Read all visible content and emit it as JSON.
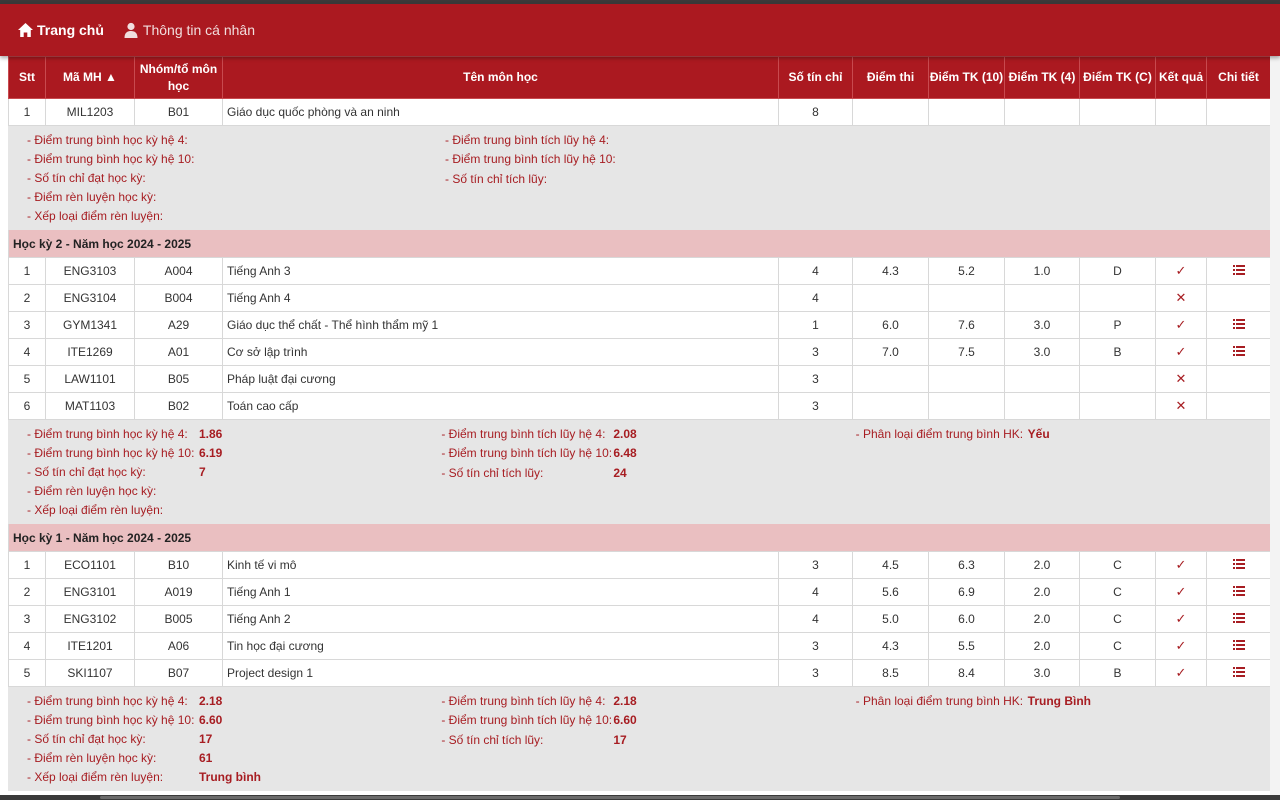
{
  "nav": {
    "home": "Trang chủ",
    "profile": "Thông tin cá nhân"
  },
  "columns": [
    "Stt",
    "Mã MH ▲",
    "Nhóm/tổ môn học",
    "Tên môn học",
    "Số tín chỉ",
    "Điểm thi",
    "Điểm TK (10)",
    "Điểm TK (4)",
    "Điểm TK (C)",
    "Kết quả",
    "Chi tiết"
  ],
  "labels": {
    "gpa4": "- Điểm trung bình học kỳ hệ 4:",
    "gpa10": "- Điểm trung bình học kỳ hệ 10:",
    "credits_sem": "- Số tín chỉ đạt học kỳ:",
    "conduct": "- Điểm rèn luyện học kỳ:",
    "conduct_rank": "- Xếp loại điểm rèn luyện:",
    "cum4": "- Điểm trung bình tích lũy hệ 4:",
    "cum10": "- Điểm trung bình tích lũy hệ 10:",
    "cum_credits": "- Số tín chỉ tích lũy:",
    "classify": "- Phân loại điểm trung bình HK:"
  },
  "first_block": {
    "row": {
      "stt": "1",
      "code": "MIL1203",
      "group": "B01",
      "name": "Giáo dục quốc phòng và an ninh",
      "credits": "8",
      "exam": "",
      "tk10": "",
      "tk4": "",
      "tkc": "",
      "result": "",
      "detail": false
    },
    "summary": {
      "gpa4": "",
      "gpa10": "",
      "credits_sem": "",
      "conduct": "",
      "conduct_rank": "",
      "cum4": "",
      "cum10": "",
      "cum_credits": "",
      "classify": ""
    }
  },
  "semesters": [
    {
      "title": "Học kỳ 2 - Năm học 2024 - 2025",
      "rows": [
        {
          "stt": "1",
          "code": "ENG3103",
          "group": "A004",
          "name": "Tiếng Anh 3",
          "credits": "4",
          "exam": "4.3",
          "tk10": "5.2",
          "tk4": "1.0",
          "tkc": "D",
          "result": "pass",
          "detail": true
        },
        {
          "stt": "2",
          "code": "ENG3104",
          "group": "B004",
          "name": "Tiếng Anh 4",
          "credits": "4",
          "exam": "",
          "tk10": "",
          "tk4": "",
          "tkc": "",
          "result": "fail",
          "detail": false
        },
        {
          "stt": "3",
          "code": "GYM1341",
          "group": "A29",
          "name": "Giáo dục thể chất - Thể hình thẩm mỹ 1",
          "credits": "1",
          "exam": "6.0",
          "tk10": "7.6",
          "tk4": "3.0",
          "tkc": "P",
          "result": "pass",
          "detail": true
        },
        {
          "stt": "4",
          "code": "ITE1269",
          "group": "A01",
          "name": "Cơ sở lập trình",
          "credits": "3",
          "exam": "7.0",
          "tk10": "7.5",
          "tk4": "3.0",
          "tkc": "B",
          "result": "pass",
          "detail": true
        },
        {
          "stt": "5",
          "code": "LAW1101",
          "group": "B05",
          "name": "Pháp luật đại cương",
          "credits": "3",
          "exam": "",
          "tk10": "",
          "tk4": "",
          "tkc": "",
          "result": "fail",
          "detail": false
        },
        {
          "stt": "6",
          "code": "MAT1103",
          "group": "B02",
          "name": "Toán cao cấp",
          "credits": "3",
          "exam": "",
          "tk10": "",
          "tk4": "",
          "tkc": "",
          "result": "fail",
          "detail": false
        }
      ],
      "summary": {
        "gpa4": "1.86",
        "gpa10": "6.19",
        "credits_sem": "7",
        "conduct": "",
        "conduct_rank": "",
        "cum4": "2.08",
        "cum10": "6.48",
        "cum_credits": "24",
        "classify": "Yếu"
      }
    },
    {
      "title": "Học kỳ 1 - Năm học 2024 - 2025",
      "rows": [
        {
          "stt": "1",
          "code": "ECO1101",
          "group": "B10",
          "name": "Kinh tế vi mô",
          "credits": "3",
          "exam": "4.5",
          "tk10": "6.3",
          "tk4": "2.0",
          "tkc": "C",
          "result": "pass",
          "detail": true
        },
        {
          "stt": "2",
          "code": "ENG3101",
          "group": "A019",
          "name": "Tiếng Anh 1",
          "credits": "4",
          "exam": "5.6",
          "tk10": "6.9",
          "tk4": "2.0",
          "tkc": "C",
          "result": "pass",
          "detail": true
        },
        {
          "stt": "3",
          "code": "ENG3102",
          "group": "B005",
          "name": "Tiếng Anh 2",
          "credits": "4",
          "exam": "5.0",
          "tk10": "6.0",
          "tk4": "2.0",
          "tkc": "C",
          "result": "pass",
          "detail": true
        },
        {
          "stt": "4",
          "code": "ITE1201",
          "group": "A06",
          "name": "Tin học đại cương",
          "credits": "3",
          "exam": "4.3",
          "tk10": "5.5",
          "tk4": "2.0",
          "tkc": "C",
          "result": "pass",
          "detail": true
        },
        {
          "stt": "5",
          "code": "SKI1107",
          "group": "B07",
          "name": "Project design 1",
          "credits": "3",
          "exam": "8.5",
          "tk10": "8.4",
          "tk4": "3.0",
          "tkc": "B",
          "result": "pass",
          "detail": true
        }
      ],
      "summary": {
        "gpa4": "2.18",
        "gpa10": "6.60",
        "credits_sem": "17",
        "conduct": "61",
        "conduct_rank": "Trung bình",
        "cum4": "2.18",
        "cum10": "6.60",
        "cum_credits": "17",
        "classify": "Trung Bình"
      }
    }
  ],
  "colors": {
    "brand": "#ab1920",
    "semester_bg": "#eabfc1",
    "summary_bg": "#e6e6e6",
    "accent_text": "#a71d22"
  },
  "icons": {
    "home": "home-icon",
    "user": "user-icon",
    "pass": "check-icon",
    "fail": "cross-icon",
    "detail": "list-icon"
  }
}
